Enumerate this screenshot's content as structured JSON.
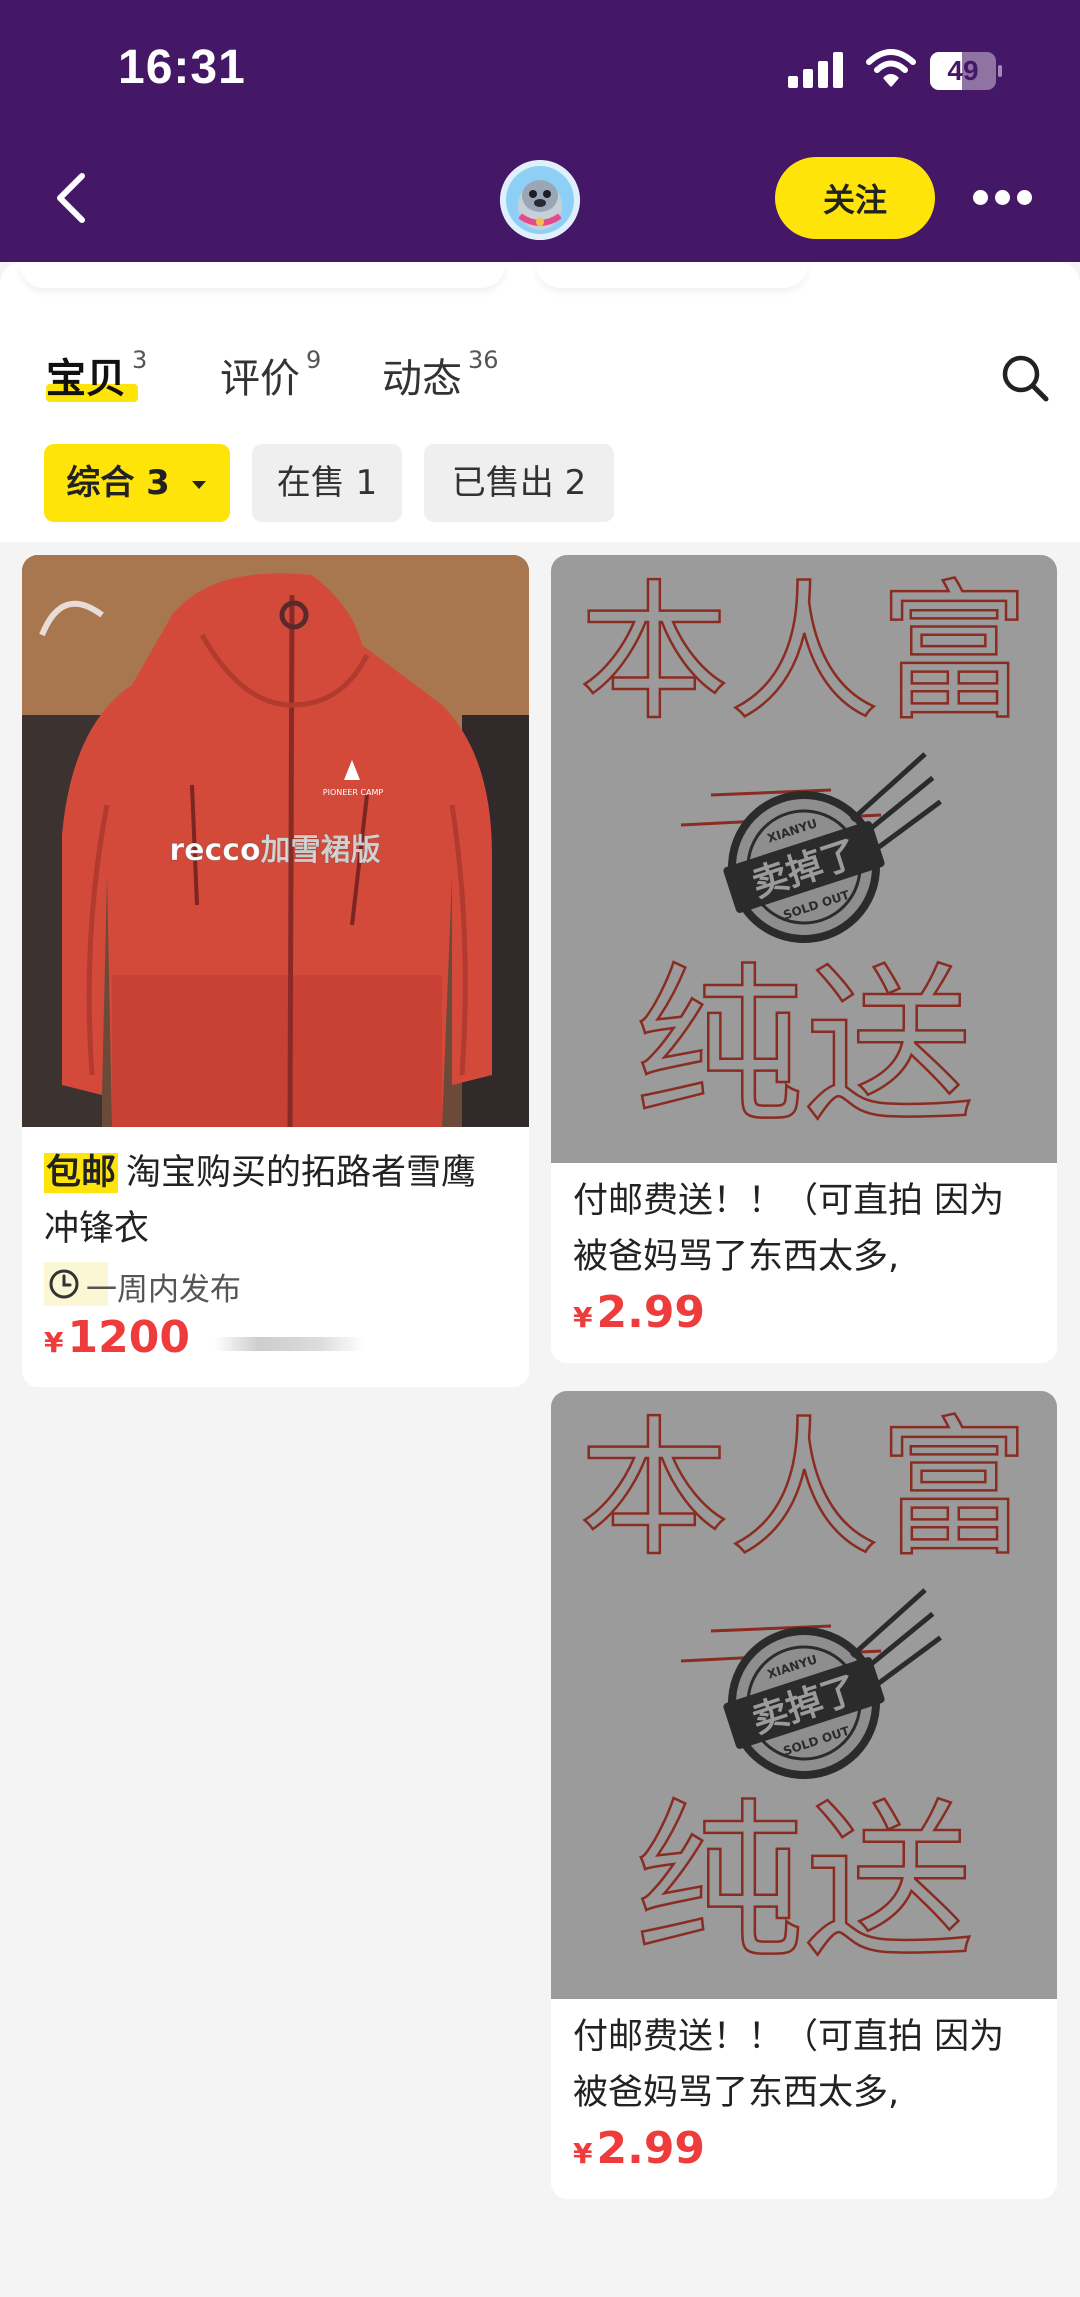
{
  "status_bar": {
    "time": "16:31",
    "battery": "49",
    "battery_level": 0.49
  },
  "header": {
    "follow_label": "关注"
  },
  "tabs": [
    {
      "label": "宝贝",
      "count": "3"
    },
    {
      "label": "评价",
      "count": "9"
    },
    {
      "label": "动态",
      "count": "36"
    }
  ],
  "filters": [
    {
      "label": "综合 3"
    },
    {
      "label": "在售 1"
    },
    {
      "label": "已售出 2"
    }
  ],
  "items": [
    {
      "badge": "包邮",
      "title": "淘宝购买的拓路者雪鹰冲锋衣",
      "image_caption": "recco加雪裙版",
      "image_logo": "PIONEER CAMP",
      "publish_time": "一周内发布",
      "currency": "¥",
      "price": "1200"
    },
    {
      "title": "付邮费送！！（可直拍 因为被爸妈骂了东西太多,",
      "handwriting": "本人富二代纯送",
      "stamp_main": "卖掉了",
      "stamp_top": "XIANYU",
      "stamp_bottom": "SOLD OUT",
      "currency": "¥",
      "price": "2.99"
    },
    {
      "title": "付邮费送！！（可直拍 因为被爸妈骂了东西太多,",
      "handwriting": "本人富二代纯送",
      "stamp_main": "卖掉了",
      "stamp_top": "XIANYU",
      "stamp_bottom": "SOLD OUT",
      "currency": "¥",
      "price": "2.99"
    }
  ]
}
